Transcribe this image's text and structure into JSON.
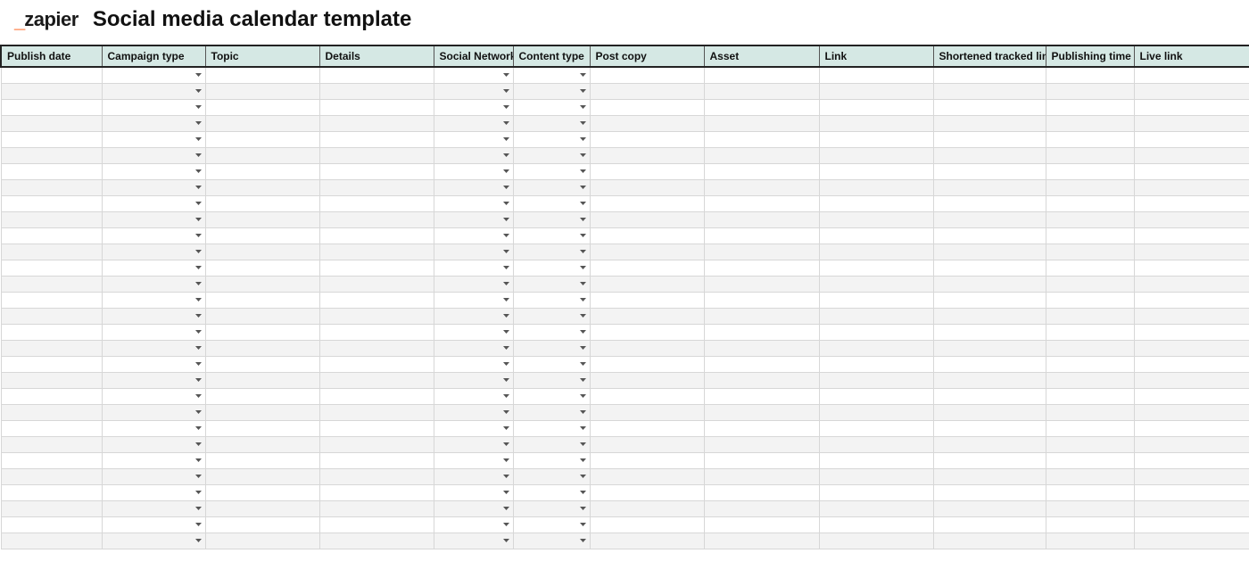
{
  "brand": {
    "name": "zapier",
    "mark": "_"
  },
  "title": "Social media calendar template",
  "columns": [
    {
      "label": "Publish date",
      "dropdown": false
    },
    {
      "label": "Campaign type",
      "dropdown": true
    },
    {
      "label": "Topic",
      "dropdown": false
    },
    {
      "label": "Details",
      "dropdown": false
    },
    {
      "label": "Social Network",
      "dropdown": true
    },
    {
      "label": "Content type",
      "dropdown": true
    },
    {
      "label": "Post copy",
      "dropdown": false
    },
    {
      "label": "Asset",
      "dropdown": false
    },
    {
      "label": "Link",
      "dropdown": false
    },
    {
      "label": "Shortened tracked link",
      "dropdown": false
    },
    {
      "label": "Publishing time",
      "dropdown": false
    },
    {
      "label": "Live link",
      "dropdown": false
    }
  ],
  "row_count": 30
}
